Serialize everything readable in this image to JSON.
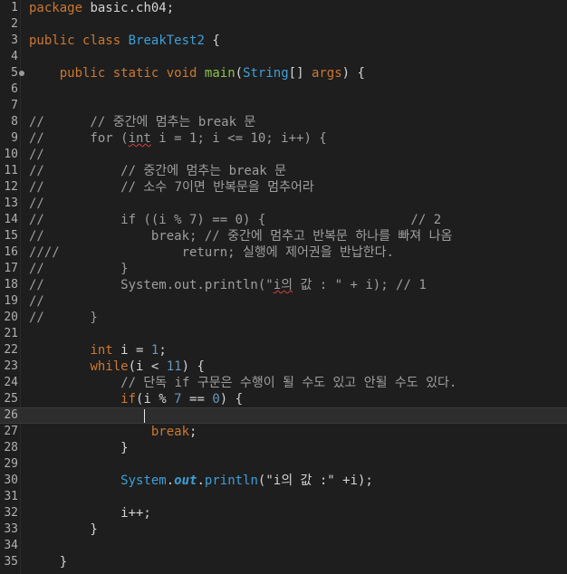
{
  "editor": {
    "lines": [
      {
        "n": "1",
        "tokens": [
          {
            "t": "package",
            "c": "kw"
          },
          {
            "t": " basic.ch04;",
            "c": "plain"
          }
        ]
      },
      {
        "n": "2",
        "tokens": []
      },
      {
        "n": "3",
        "tokens": [
          {
            "t": "public",
            "c": "kw"
          },
          {
            "t": " ",
            "c": "plain"
          },
          {
            "t": "class",
            "c": "kw"
          },
          {
            "t": " ",
            "c": "plain"
          },
          {
            "t": "BreakTest2",
            "c": "type"
          },
          {
            "t": " {",
            "c": "plain"
          }
        ]
      },
      {
        "n": "4",
        "tokens": []
      },
      {
        "n": "5",
        "fold": true,
        "tokens": [
          {
            "t": "    ",
            "c": "plain"
          },
          {
            "t": "public",
            "c": "kw"
          },
          {
            "t": " ",
            "c": "plain"
          },
          {
            "t": "static",
            "c": "kw"
          },
          {
            "t": " ",
            "c": "plain"
          },
          {
            "t": "void",
            "c": "kw"
          },
          {
            "t": " ",
            "c": "plain"
          },
          {
            "t": "main",
            "c": "method"
          },
          {
            "t": "(",
            "c": "plain"
          },
          {
            "t": "String",
            "c": "type"
          },
          {
            "t": "[] ",
            "c": "plain"
          },
          {
            "t": "args",
            "c": "kw"
          },
          {
            "t": ") {",
            "c": "plain"
          }
        ]
      },
      {
        "n": "6",
        "tokens": []
      },
      {
        "n": "7",
        "tokens": []
      },
      {
        "n": "8",
        "tokens": [
          {
            "t": "//      // 중간에 멈추는 break 문",
            "c": "cmt"
          }
        ]
      },
      {
        "n": "9",
        "tokens": [
          {
            "t": "//      for (",
            "c": "cmt"
          },
          {
            "t": "int",
            "c": "cmt squig"
          },
          {
            "t": " i = 1; i <= 10; i++) {",
            "c": "cmt"
          }
        ]
      },
      {
        "n": "10",
        "tokens": [
          {
            "t": "//",
            "c": "cmt"
          }
        ]
      },
      {
        "n": "11",
        "tokens": [
          {
            "t": "//          // 중간에 멈추는 break 문",
            "c": "cmt"
          }
        ]
      },
      {
        "n": "12",
        "tokens": [
          {
            "t": "//          // 소수 7이면 반복문을 멈추어라",
            "c": "cmt"
          }
        ]
      },
      {
        "n": "13",
        "tokens": [
          {
            "t": "//",
            "c": "cmt"
          }
        ]
      },
      {
        "n": "14",
        "tokens": [
          {
            "t": "//          if ((i % 7) == 0) {                   // 2",
            "c": "cmt"
          }
        ]
      },
      {
        "n": "15",
        "tokens": [
          {
            "t": "//              break; // 중간에 멈추고 반복문 하나를 빠져 나옴",
            "c": "cmt"
          }
        ]
      },
      {
        "n": "16",
        "tokens": [
          {
            "t": "////                return; 실행에 제어권을 반납한다.",
            "c": "cmt"
          }
        ]
      },
      {
        "n": "17",
        "tokens": [
          {
            "t": "//          }",
            "c": "cmt"
          }
        ]
      },
      {
        "n": "18",
        "tokens": [
          {
            "t": "//          System.out.println(\"",
            "c": "cmt"
          },
          {
            "t": "i의",
            "c": "cmt squig"
          },
          {
            "t": " 값 : \" + i); // 1",
            "c": "cmt"
          }
        ]
      },
      {
        "n": "19",
        "tokens": [
          {
            "t": "//",
            "c": "cmt"
          }
        ]
      },
      {
        "n": "20",
        "tokens": [
          {
            "t": "//      }",
            "c": "cmt"
          }
        ]
      },
      {
        "n": "21",
        "tokens": []
      },
      {
        "n": "22",
        "tokens": [
          {
            "t": "        ",
            "c": "plain"
          },
          {
            "t": "int",
            "c": "kw"
          },
          {
            "t": " i = ",
            "c": "plain"
          },
          {
            "t": "1",
            "c": "num"
          },
          {
            "t": ";",
            "c": "plain"
          }
        ]
      },
      {
        "n": "23",
        "tokens": [
          {
            "t": "        ",
            "c": "plain"
          },
          {
            "t": "while",
            "c": "kw"
          },
          {
            "t": "(i < ",
            "c": "plain"
          },
          {
            "t": "11",
            "c": "num"
          },
          {
            "t": ") {",
            "c": "plain"
          }
        ]
      },
      {
        "n": "24",
        "tokens": [
          {
            "t": "            // 단독 if 구문은 수행이 될 수도 있고 안될 수도 있다.",
            "c": "cmt"
          }
        ]
      },
      {
        "n": "25",
        "tokens": [
          {
            "t": "            ",
            "c": "plain"
          },
          {
            "t": "if",
            "c": "kw"
          },
          {
            "t": "(i % ",
            "c": "plain"
          },
          {
            "t": "7",
            "c": "num"
          },
          {
            "t": " == ",
            "c": "plain"
          },
          {
            "t": "0",
            "c": "num"
          },
          {
            "t": ") {",
            "c": "plain"
          }
        ]
      },
      {
        "n": "26",
        "current": true,
        "tokens": []
      },
      {
        "n": "27",
        "tokens": [
          {
            "t": "                ",
            "c": "plain"
          },
          {
            "t": "break",
            "c": "kw"
          },
          {
            "t": ";",
            "c": "plain"
          }
        ]
      },
      {
        "n": "28",
        "tokens": [
          {
            "t": "            }",
            "c": "plain"
          }
        ]
      },
      {
        "n": "29",
        "tokens": []
      },
      {
        "n": "30",
        "tokens": [
          {
            "t": "            ",
            "c": "plain"
          },
          {
            "t": "System",
            "c": "type"
          },
          {
            "t": ".",
            "c": "plain"
          },
          {
            "t": "out",
            "c": "field"
          },
          {
            "t": ".",
            "c": "plain"
          },
          {
            "t": "println",
            "c": "type"
          },
          {
            "t": "(\"i의 값 :\" +i);",
            "c": "plain"
          }
        ]
      },
      {
        "n": "31",
        "tokens": []
      },
      {
        "n": "32",
        "tokens": [
          {
            "t": "            i++;",
            "c": "plain"
          }
        ]
      },
      {
        "n": "33",
        "tokens": [
          {
            "t": "        }",
            "c": "plain"
          }
        ]
      },
      {
        "n": "34",
        "tokens": []
      },
      {
        "n": "35",
        "tokens": [
          {
            "t": "    }",
            "c": "plain"
          }
        ]
      }
    ]
  }
}
